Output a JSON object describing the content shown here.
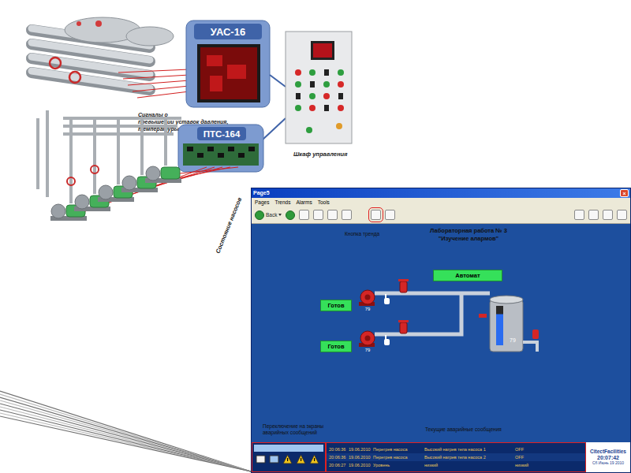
{
  "illustration": {
    "uas": "УАС-16",
    "pts": "ПТС-164",
    "cabinet": "Шкаф управления",
    "signals": [
      "Сигналы о",
      "превышении уставок давления,",
      "температуры,уровня ..."
    ],
    "pumps_state": "Состояние насосов"
  },
  "window": {
    "title": "Page5",
    "close": "×"
  },
  "menu": [
    "Pages",
    "Trends",
    "Alarms",
    "Tools"
  ],
  "toolbar": {
    "back": "Back"
  },
  "annotations": {
    "trend_button": "Кнопка тренда",
    "alarm_screens": [
      "Переключение на экраны",
      "аварийных сообщений"
    ],
    "current_alarms": "Текущие аварийные сообщения"
  },
  "heading": [
    "Лабораторная работа № 3",
    "\"Изучение алармов\""
  ],
  "mode": {
    "label": "Автомат"
  },
  "pumps": [
    {
      "status": "Готов",
      "value": "79"
    },
    {
      "status": "Готов",
      "value": "79"
    }
  ],
  "tank": {
    "value": "79",
    "level": 0.79
  },
  "alarms": [
    [
      "20:06:36",
      "19.06.2010",
      "Перегрев насоса",
      "Высокий нагрев тела насоса 1",
      "OFF"
    ],
    [
      "20:06:36",
      "19.06.2010",
      "Перегрев насоса",
      "Высокий нагрев тела насоса 2",
      "OFF"
    ],
    [
      "20:06:27",
      "19.06.2010",
      "Уровень",
      "низкий",
      "низкий"
    ]
  ],
  "status": {
    "logo": "CitectFacilities",
    "time": "20:07:42",
    "date": "Сб Июнь 19 2010"
  }
}
